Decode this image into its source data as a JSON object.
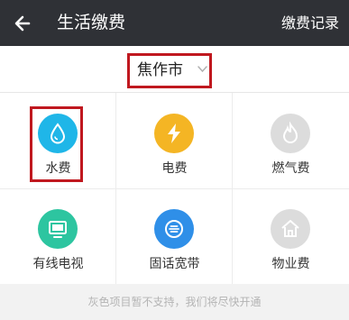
{
  "header": {
    "back_icon": "arrow-left-icon",
    "title": "生活缴费",
    "records_label": "缴费记录",
    "bg_color": "#2f3136"
  },
  "city": {
    "name": "焦作市",
    "dropdown_icon": "chevron-down-icon",
    "highlight_color": "#c0181f"
  },
  "services": [
    {
      "label": "水费",
      "icon": "water-drop-icon",
      "color": "#1fb6e8",
      "enabled": true,
      "highlighted": true
    },
    {
      "label": "电费",
      "icon": "lightning-icon",
      "color": "#f4b524",
      "enabled": true
    },
    {
      "label": "燃气费",
      "icon": "flame-icon",
      "color": "#dcdcdc",
      "enabled": false
    },
    {
      "label": "有线电视",
      "icon": "tv-icon",
      "color": "#2dc5a0",
      "enabled": true
    },
    {
      "label": "固话宽带",
      "icon": "landline-icon",
      "color": "#2f8fe8",
      "enabled": true
    },
    {
      "label": "物业费",
      "icon": "house-icon",
      "color": "#dcdcdc",
      "enabled": false
    }
  ],
  "footer": {
    "notice": "灰色项目暂不支持，我们将尽快开通"
  }
}
